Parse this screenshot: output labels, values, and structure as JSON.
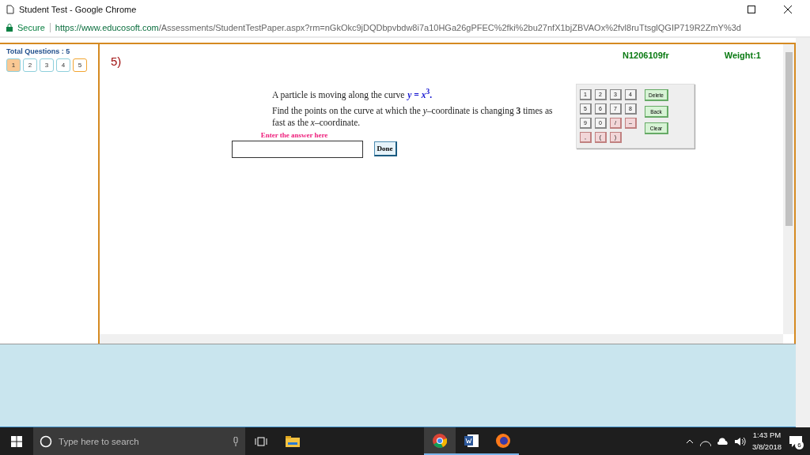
{
  "window": {
    "title": "Student Test - Google Chrome"
  },
  "address_bar": {
    "security": "Secure",
    "url_host": "https://www.educosoft.com",
    "url_path": "/Assessments/StudentTestPaper.aspx?rm=nGkOkc9jDQDbpvbdw8i7a10HGa26gPFEC%2fki%2bu27nfX1bjZBVAOx%2fvl8ruTtsglQGIP719R2ZmY%3d"
  },
  "sidebar": {
    "total_label": "Total Questions : 5",
    "questions": [
      {
        "label": "1",
        "selected": true,
        "current": false
      },
      {
        "label": "2",
        "selected": false,
        "current": false
      },
      {
        "label": "3",
        "selected": false,
        "current": false
      },
      {
        "label": "4",
        "selected": false,
        "current": false
      },
      {
        "label": "5",
        "selected": false,
        "current": true
      }
    ]
  },
  "question": {
    "number": "5)",
    "code": "N1206109fr",
    "weight": "Weight:1",
    "line_1": "A particle is moving along the curve",
    "equation": "*y*  =  *x*$^{3}$.",
    "line_2": "Find the points on the curve at which the *y*–coordinate is changing **3** times as fast as the *x*–coordinate.",
    "answer_prompt": "Enter the answer here",
    "done": "Done"
  },
  "keypad": {
    "keys": [
      {
        "label": "1",
        "kind": "digit"
      },
      {
        "label": "2",
        "kind": "digit"
      },
      {
        "label": "3",
        "kind": "digit"
      },
      {
        "label": "4",
        "kind": "digit"
      },
      {
        "label": "5",
        "kind": "digit"
      },
      {
        "label": "6",
        "kind": "digit"
      },
      {
        "label": "7",
        "kind": "digit"
      },
      {
        "label": "8",
        "kind": "digit"
      },
      {
        "label": "9",
        "kind": "digit"
      },
      {
        "label": "0",
        "kind": "digit"
      },
      {
        "label": "/",
        "kind": "symbol"
      },
      {
        "label": "–",
        "kind": "symbol"
      },
      {
        "label": ",",
        "kind": "symbol"
      },
      {
        "label": "(",
        "kind": "symbol"
      },
      {
        "label": ")",
        "kind": "symbol"
      }
    ],
    "actions": [
      "Delete",
      "Back",
      "Clear"
    ]
  },
  "taskbar": {
    "search_placeholder": "Type here to search",
    "time": "1:43 PM",
    "date": "3/8/2018",
    "notifications": "6"
  }
}
